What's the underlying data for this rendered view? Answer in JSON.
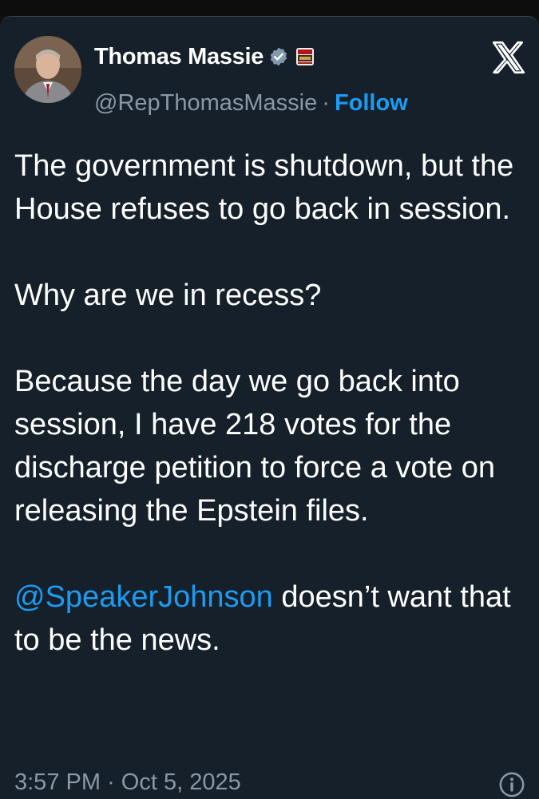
{
  "author": {
    "display_name": "Thomas Massie",
    "handle": "@RepThomasMassie",
    "separator": "·",
    "follow_label": "Follow"
  },
  "tweet": {
    "paragraph_1": "The government is shutdown, but the House refuses to go back in session.",
    "paragraph_2": "Why are we in recess?",
    "paragraph_3": "Because the day we go back into session, I have 218 votes for the discharge petition to force a vote on releasing the Epstein files.",
    "mention": "@SpeakerJohnson",
    "paragraph_4_rest": " doesn’t want that to be the news."
  },
  "meta": {
    "time": "3:57 PM",
    "separator": "·",
    "date": "Oct 5, 2025"
  },
  "icons": {
    "verified": "verified-badge-icon",
    "affiliate": "affiliate-badge-icon",
    "brand": "x-logo-icon",
    "info": "info-icon"
  },
  "colors": {
    "background": "#15202b",
    "text": "#ffffff",
    "secondary": "#8b98a5",
    "accent": "#1d9bf0"
  }
}
